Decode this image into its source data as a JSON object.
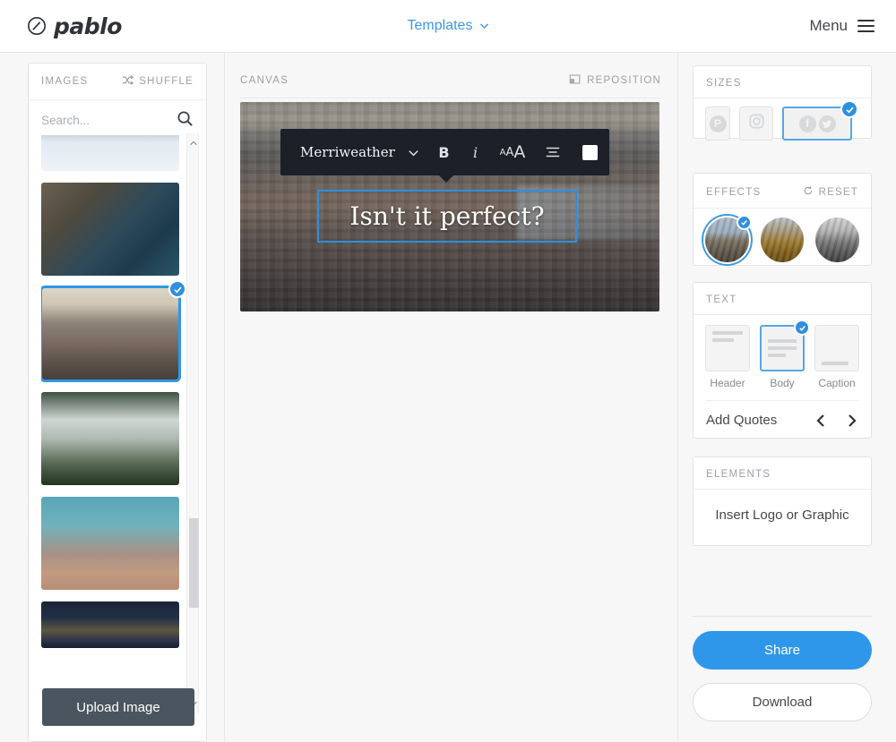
{
  "header": {
    "logo_text": "pablo",
    "logo_icon": "pablo-circle-icon",
    "templates_label": "Templates",
    "templates_chevron": "chevron-down-icon",
    "menu_label": "Menu",
    "menu_icon": "hamburger-icon",
    "accent_color": "#3b98ec"
  },
  "images_panel": {
    "title": "IMAGES",
    "shuffle_label": "SHUFFLE",
    "shuffle_icon": "shuffle-icon",
    "search_placeholder": "Search...",
    "search_value": "",
    "search_icon": "search-icon",
    "upload_label": "Upload Image",
    "scroll_up_icon": "chevron-up-icon",
    "scroll_down_icon": "chevron-down-icon",
    "thumbnails": [
      {
        "name": "snowy-lake",
        "selected": false
      },
      {
        "name": "coastal-cliffs",
        "selected": false
      },
      {
        "name": "city-skyline-aerial",
        "selected": true
      },
      {
        "name": "foggy-mountain-valley",
        "selected": false
      },
      {
        "name": "grasses-teal-sky",
        "selected": false
      },
      {
        "name": "lit-stone-steps",
        "selected": false
      }
    ]
  },
  "canvas_panel": {
    "title": "CANVAS",
    "reposition_label": "REPOSITION",
    "reposition_icon": "reposition-icon",
    "image_name": "city-skyline-aerial",
    "toolbar": {
      "font_name": "Merriweather",
      "dropdown_icon": "chevron-down-icon",
      "bold_label": "B",
      "italic_label": "i",
      "size_label": "AAA",
      "align_icon": "align-center-icon",
      "color_swatch": "#ffffff"
    },
    "caption_text": "Isn't it perfect?",
    "selection_color": "#2f8fe0"
  },
  "sizes": {
    "title": "SIZES",
    "options": [
      {
        "name": "pinterest",
        "icon": "pinterest-icon",
        "selected": false
      },
      {
        "name": "instagram",
        "icon": "instagram-icon",
        "selected": false
      },
      {
        "name": "facebook-twitter",
        "icon": "facebook-twitter-icon",
        "selected": true
      }
    ]
  },
  "effects": {
    "title": "EFFECTS",
    "reset_label": "RESET",
    "reset_icon": "reset-circle-icon",
    "options": [
      {
        "name": "normal",
        "selected": true
      },
      {
        "name": "sepia",
        "selected": false
      },
      {
        "name": "grayscale",
        "selected": false
      }
    ]
  },
  "text": {
    "title": "TEXT",
    "options": [
      {
        "label": "Header",
        "selected": false
      },
      {
        "label": "Body",
        "selected": true
      },
      {
        "label": "Caption",
        "selected": false
      }
    ],
    "quotes_label": "Add Quotes",
    "prev_icon": "chevron-left-icon",
    "next_icon": "chevron-right-icon"
  },
  "elements": {
    "title": "ELEMENTS",
    "insert_label": "Insert Logo or Graphic"
  },
  "actions": {
    "share_label": "Share",
    "download_label": "Download",
    "share_color": "#2f97ea"
  }
}
